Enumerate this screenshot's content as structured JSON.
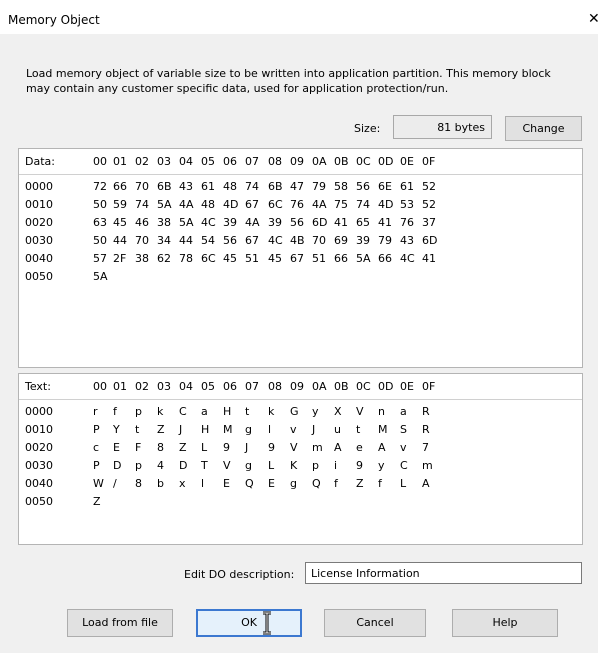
{
  "window": {
    "title": "Memory Object",
    "close_glyph": "✕"
  },
  "description": "Load memory object of variable size to be written into application partition. This memory block may contain any customer specific data, used for application protection/run.",
  "size": {
    "label": "Size:",
    "value": "81 bytes",
    "change_label": "Change"
  },
  "columns": [
    "00",
    "01",
    "02",
    "03",
    "04",
    "05",
    "06",
    "07",
    "08",
    "09",
    "0A",
    "0B",
    "0C",
    "0D",
    "0E",
    "0F"
  ],
  "data_grid": {
    "header": "Data:",
    "rows": [
      {
        "addr": "0000",
        "cells": [
          "72",
          "66",
          "70",
          "6B",
          "43",
          "61",
          "48",
          "74",
          "6B",
          "47",
          "79",
          "58",
          "56",
          "6E",
          "61",
          "52"
        ]
      },
      {
        "addr": "0010",
        "cells": [
          "50",
          "59",
          "74",
          "5A",
          "4A",
          "48",
          "4D",
          "67",
          "6C",
          "76",
          "4A",
          "75",
          "74",
          "4D",
          "53",
          "52"
        ]
      },
      {
        "addr": "0020",
        "cells": [
          "63",
          "45",
          "46",
          "38",
          "5A",
          "4C",
          "39",
          "4A",
          "39",
          "56",
          "6D",
          "41",
          "65",
          "41",
          "76",
          "37"
        ]
      },
      {
        "addr": "0030",
        "cells": [
          "50",
          "44",
          "70",
          "34",
          "44",
          "54",
          "56",
          "67",
          "4C",
          "4B",
          "70",
          "69",
          "39",
          "79",
          "43",
          "6D"
        ]
      },
      {
        "addr": "0040",
        "cells": [
          "57",
          "2F",
          "38",
          "62",
          "78",
          "6C",
          "45",
          "51",
          "45",
          "67",
          "51",
          "66",
          "5A",
          "66",
          "4C",
          "41"
        ]
      },
      {
        "addr": "0050",
        "cells": [
          "5A"
        ]
      }
    ]
  },
  "text_grid": {
    "header": "Text:",
    "rows": [
      {
        "addr": "0000",
        "cells": [
          "r",
          "f",
          "p",
          "k",
          "C",
          "a",
          "H",
          "t",
          "k",
          "G",
          "y",
          "X",
          "V",
          "n",
          "a",
          "R"
        ]
      },
      {
        "addr": "0010",
        "cells": [
          "P",
          "Y",
          "t",
          "Z",
          "J",
          "H",
          "M",
          "g",
          "l",
          "v",
          "J",
          "u",
          "t",
          "M",
          "S",
          "R"
        ]
      },
      {
        "addr": "0020",
        "cells": [
          "c",
          "E",
          "F",
          "8",
          "Z",
          "L",
          "9",
          "J",
          "9",
          "V",
          "m",
          "A",
          "e",
          "A",
          "v",
          "7"
        ]
      },
      {
        "addr": "0030",
        "cells": [
          "P",
          "D",
          "p",
          "4",
          "D",
          "T",
          "V",
          "g",
          "L",
          "K",
          "p",
          "i",
          "9",
          "y",
          "C",
          "m"
        ]
      },
      {
        "addr": "0040",
        "cells": [
          "W",
          "/",
          "8",
          "b",
          "x",
          "l",
          "E",
          "Q",
          "E",
          "g",
          "Q",
          "f",
          "Z",
          "f",
          "L",
          "A"
        ]
      },
      {
        "addr": "0050",
        "cells": [
          "Z"
        ]
      }
    ]
  },
  "edit_description": {
    "label": "Edit DO description:",
    "value": "License Information"
  },
  "buttons": {
    "load": "Load from file",
    "ok": "OK",
    "cancel": "Cancel",
    "help": "Help"
  },
  "icons": {
    "close": "close-icon",
    "cursor": "text-cursor-icon"
  }
}
